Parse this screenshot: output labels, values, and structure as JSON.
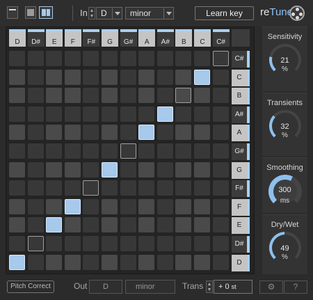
{
  "toolbar": {
    "in_label": "In",
    "key_value": "D",
    "scale_value": "minor",
    "learn_label": "Learn key",
    "brand_prefix": "re",
    "brand_suffix": "Tune"
  },
  "grid": {
    "columns": [
      "D",
      "D#",
      "E",
      "F",
      "F#",
      "G",
      "G#",
      "A",
      "A#",
      "B",
      "C",
      "C#"
    ],
    "rows": [
      "C#",
      "C",
      "B",
      "A#",
      "A",
      "G#",
      "G",
      "F#",
      "F",
      "E",
      "D#",
      "D"
    ],
    "active_cells": [
      [
        11,
        0
      ],
      [
        9,
        2
      ],
      [
        8,
        3
      ],
      [
        6,
        5
      ],
      [
        4,
        7
      ],
      [
        3,
        8
      ],
      [
        1,
        10
      ]
    ],
    "outlined_cells": [
      [
        7,
        4
      ],
      [
        5,
        6
      ],
      [
        2,
        9
      ],
      [
        0,
        11
      ],
      [
        10,
        1
      ]
    ]
  },
  "knobs": [
    {
      "title": "Sensitivity",
      "value": "21",
      "unit": "%",
      "level": 0.21
    },
    {
      "title": "Transients",
      "value": "32",
      "unit": "%",
      "level": 0.32
    },
    {
      "title": "Smoothing",
      "value": "300",
      "unit": "ms",
      "level": 0.6
    },
    {
      "title": "Dry/Wet",
      "value": "49",
      "unit": "%",
      "level": 0.49
    }
  ],
  "bottom": {
    "pitch_correct_label": "Pitch Correct",
    "out_label": "Out",
    "out_key": "D",
    "out_scale": "minor",
    "trans_label": "Trans",
    "trans_value": "+ 0",
    "trans_unit": "st",
    "settings_icon": "gear-icon",
    "help_label": "?"
  },
  "colors": {
    "accent": "#a6c9ec",
    "background": "#2b2b2b"
  }
}
